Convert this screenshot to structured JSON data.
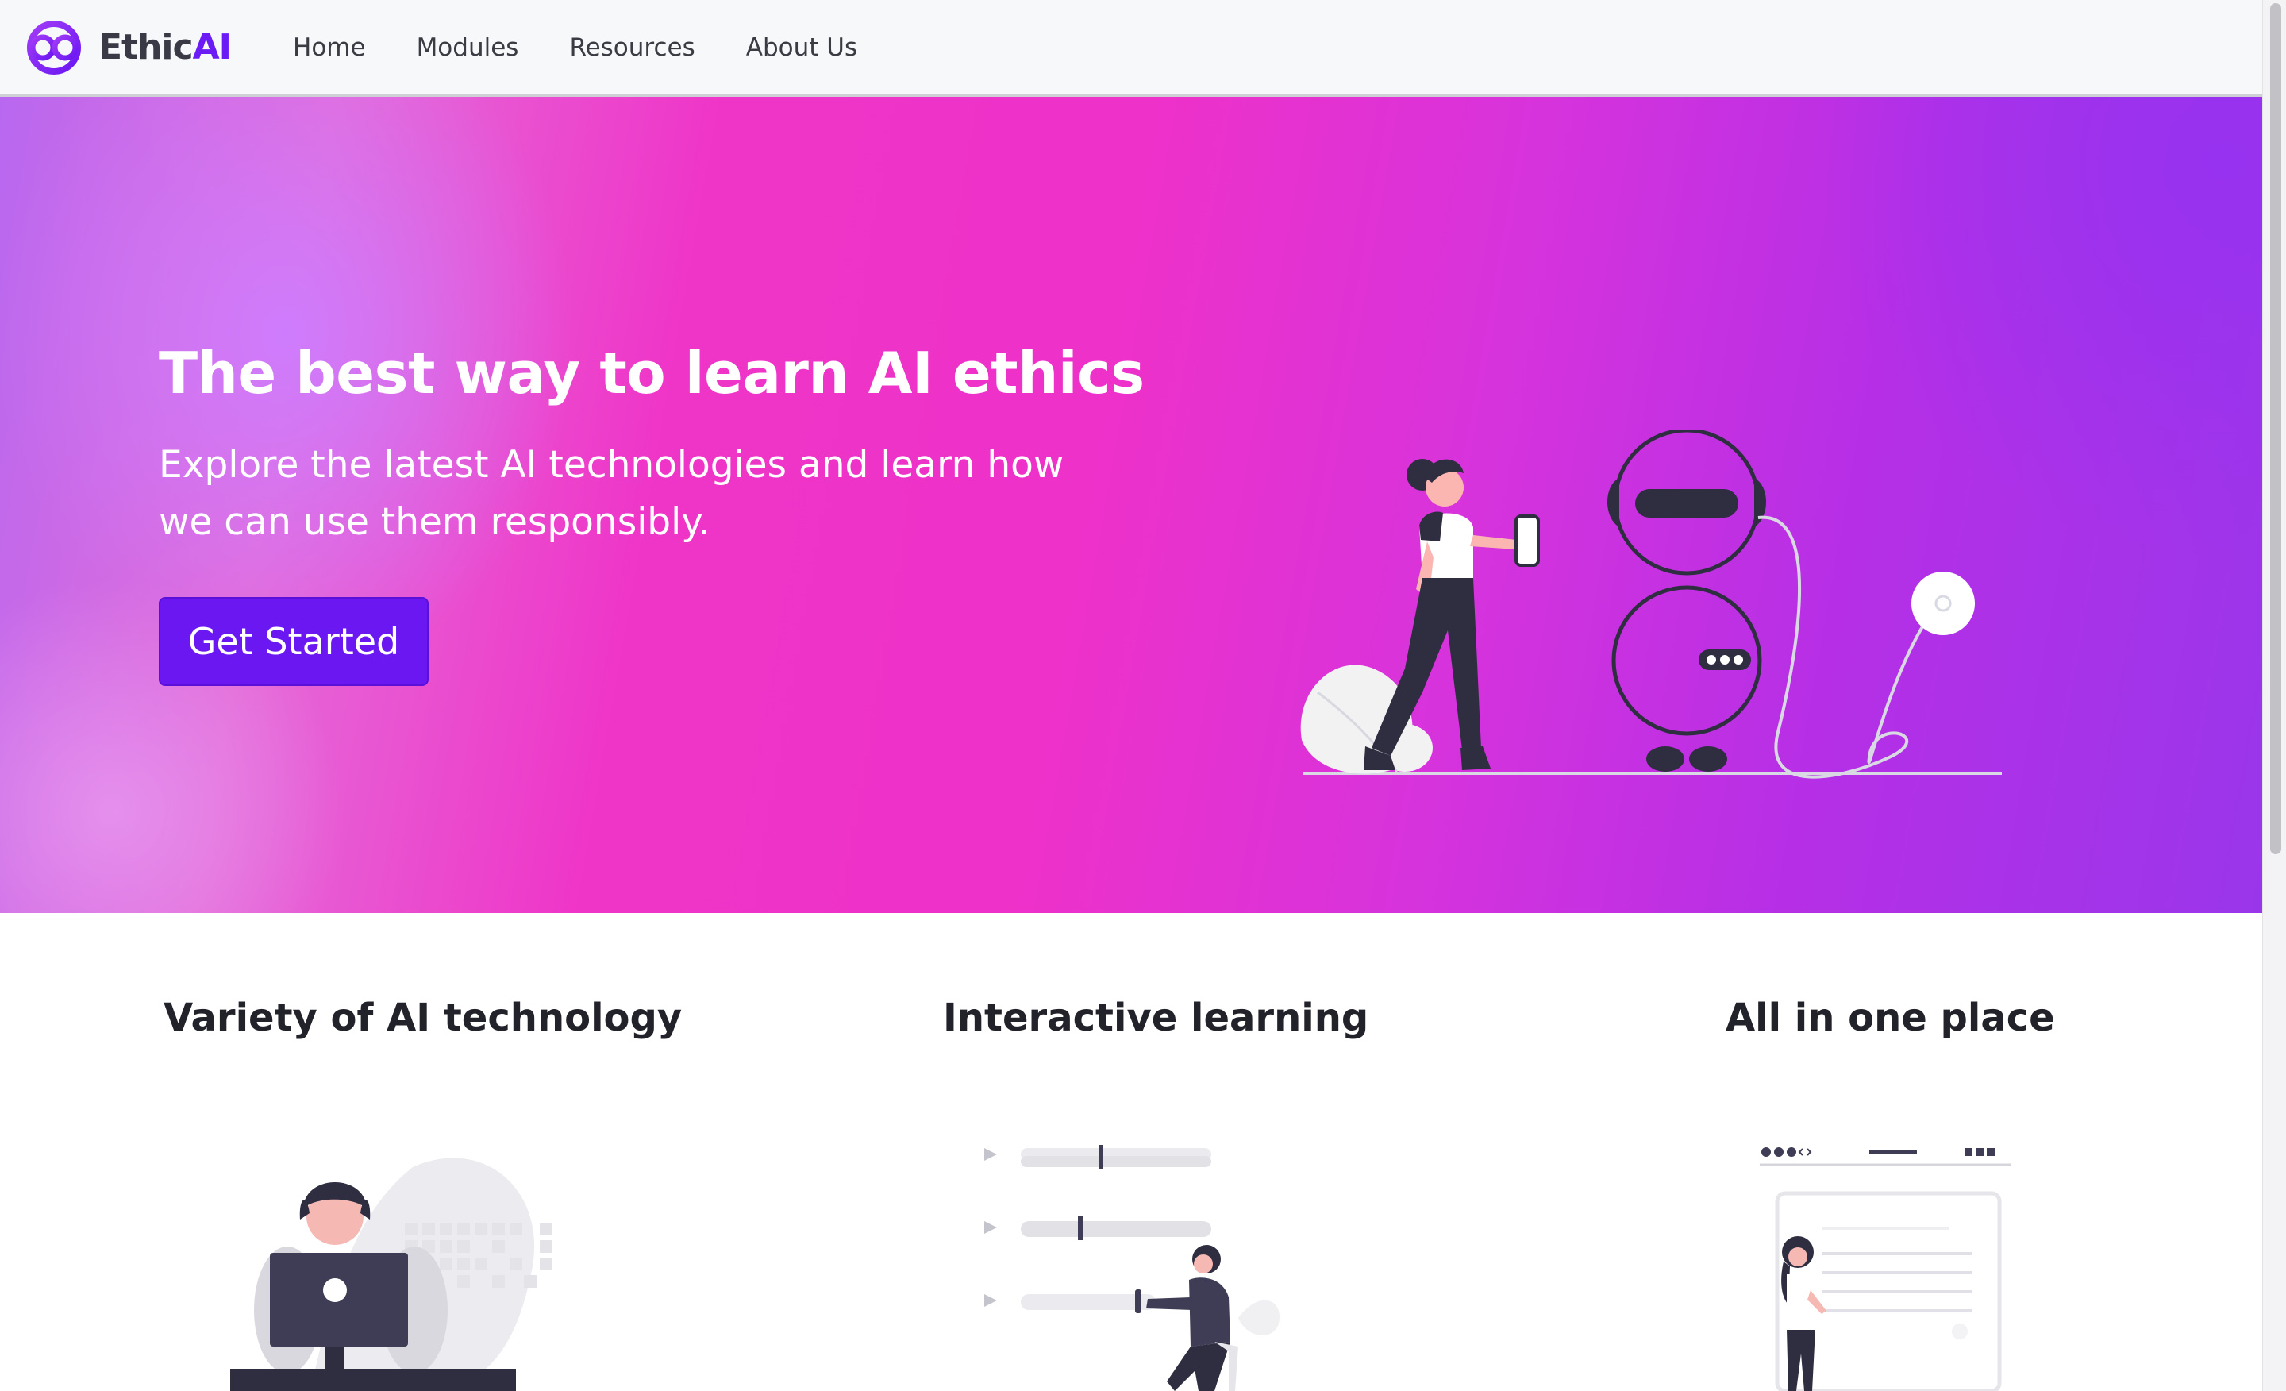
{
  "brand": {
    "name_part1": "Ethic",
    "name_part2": "AI",
    "logo_icon": "infinity-rings-logo",
    "accent_color": "#6b1cf5"
  },
  "nav": {
    "items": [
      {
        "label": "Home"
      },
      {
        "label": "Modules"
      },
      {
        "label": "Resources"
      },
      {
        "label": "About Us"
      }
    ]
  },
  "hero": {
    "title": "The best way to learn AI ethics",
    "subtitle": "Explore the latest AI technologies and learn how we can use them responsibly.",
    "cta_label": "Get Started",
    "cta_color": "#6a17f2",
    "illustration": "woman-with-phone-and-robot-illustration"
  },
  "features": [
    {
      "title": "Variety of AI technology",
      "illustration": "person-at-computer-illustration"
    },
    {
      "title": "Interactive learning",
      "illustration": "person-with-sliders-illustration"
    },
    {
      "title": "All in one place",
      "illustration": "person-at-browser-window-illustration"
    }
  ]
}
